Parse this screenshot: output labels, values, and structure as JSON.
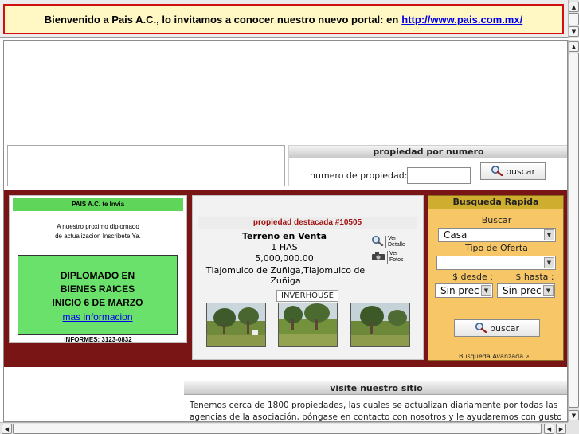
{
  "banner": {
    "text": "Bienvenido a Pais A.C., lo invitamos a conocer nuestro nuevo portal: en",
    "link": "http://www.pais.com.mx/"
  },
  "property_number": {
    "header": "propiedad por numero",
    "label": "numero de propiedad:",
    "input_value": "",
    "button_label": "buscar"
  },
  "invite": {
    "header": "PAIS A.C. te Invia",
    "text_line1": "A nuestro proximo diplomado",
    "text_line2": "de actualizacion  Inscribete Ya.",
    "box_line1": "DIPLOMADO EN",
    "box_line2": "BIENES RAICES",
    "box_line3": "INICIO  6 DE MARZO",
    "box_link": "mas informacion",
    "contact": "INFORMES: 3123-0832"
  },
  "featured": {
    "title": "propiedad destacada #10505",
    "type": "Terreno en Venta",
    "area": "1 HAS",
    "price": "5,000,000.00",
    "location_line1": "Tlajomulco de Zuñiga,Tlajomulco de",
    "location_line2": "Zuñiga",
    "agency": "INVERHOUSE",
    "detail_link_line1": "Ver",
    "detail_link_line2": "Detalle",
    "photos_link_line1": "Ver",
    "photos_link_line2": "Fotos"
  },
  "quick_search": {
    "header": "Busqueda Rapida",
    "search_label": "Buscar",
    "search_value": "Casa",
    "offer_label": "Tipo de Oferta",
    "offer_value": "",
    "from_label": "$ desde :",
    "to_label": "$ hasta :",
    "from_value": "Sin prec",
    "to_value": "Sin prec",
    "button_label": "buscar",
    "advanced_link": "Busqueda Avanzada"
  },
  "visit": {
    "header": "visite nuestro sitio",
    "line1": "Tenemos cerca de 1800 propiedades, las cuales se actualizan diariamente por todas las",
    "line2": "agencias de la asociación, póngase en contacto con nosotros y le ayudaremos con gusto"
  },
  "colors": {
    "banner_bg": "#fff7c4",
    "banner_border": "#d01010",
    "section_bg": "#7a1515",
    "invite_header": "#5fd65a",
    "diploma_box": "#6ae16a",
    "quick_bg": "#f6c667",
    "quick_header": "#cfae2f",
    "featured_title": "#a01010"
  }
}
